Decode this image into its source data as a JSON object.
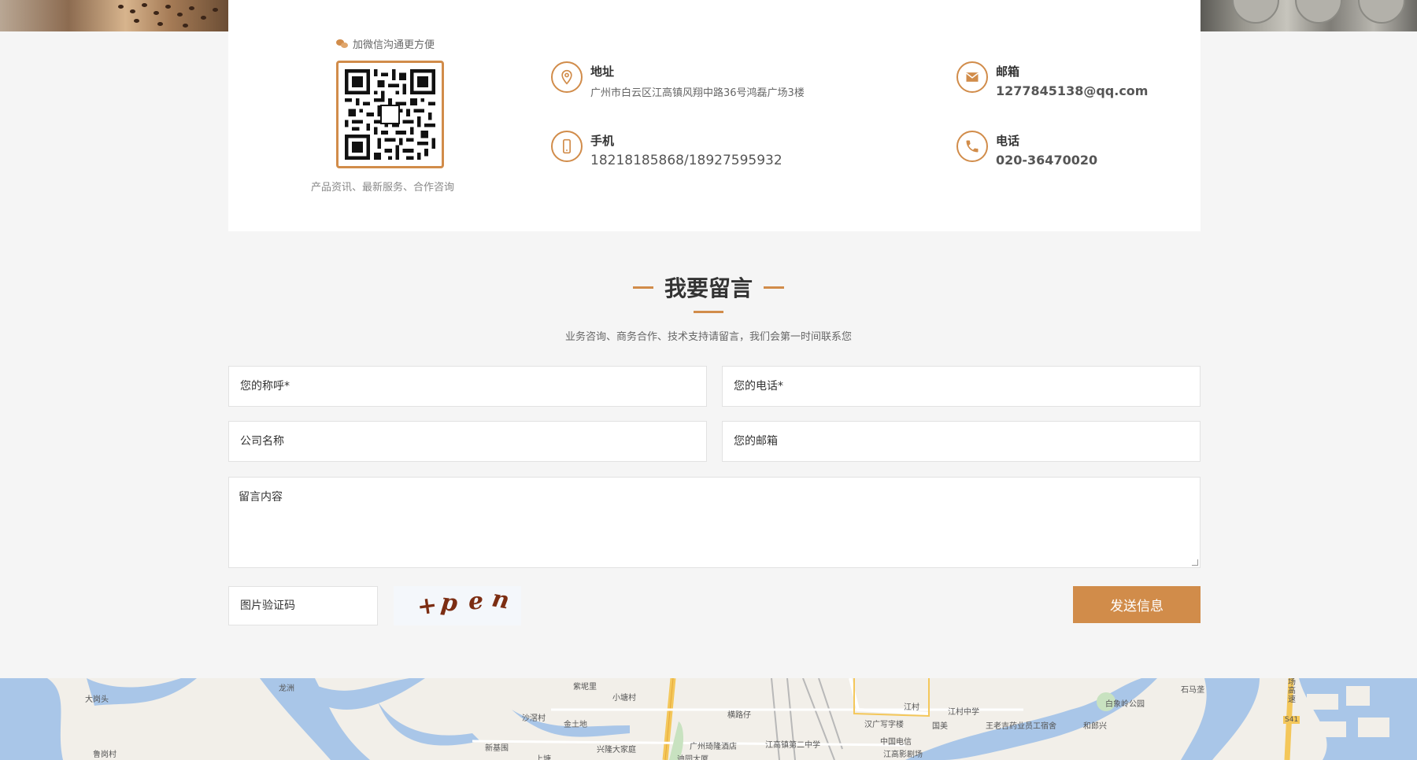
{
  "wechat": {
    "title": "加微信沟通更方便",
    "subtitle": "产品资讯、最新服务、合作咨询"
  },
  "contact": {
    "address": {
      "label": "地址",
      "value": "广州市白云区江高镇风翔中路36号鸿磊广场3楼"
    },
    "email": {
      "label": "邮箱",
      "value": "1277845138@qq.com"
    },
    "mobile": {
      "label": "手机",
      "value": "18218185868/18927595932"
    },
    "phone": {
      "label": "电话",
      "value": "020-36470020"
    }
  },
  "message": {
    "title": "我要留言",
    "subtitle": "业务咨询、商务合作、技术支持请留言，我们会第一时间联系您"
  },
  "form": {
    "name_placeholder": "您的称呼*",
    "phone_placeholder": "您的电话*",
    "company_placeholder": "公司名称",
    "email_placeholder": "您的邮箱",
    "content_placeholder": "留言内容",
    "captcha_placeholder": "图片验证码",
    "captcha_chars": [
      "+",
      "p",
      "e",
      "n"
    ],
    "submit_label": "发送信息"
  },
  "map": {
    "places": [
      "大岗头",
      "龙洲",
      "鲁岗村",
      "紫坭里",
      "小塘村",
      "沙滘村",
      "金土地",
      "新基围",
      "上塘",
      "兴隆大家庭",
      "横路仔",
      "广州琦隆酒店",
      "江高镇第二中学",
      "迪园大厦",
      "江村",
      "江村中学",
      "汉广写字楼",
      "国美",
      "王老吉药业员工宿舍",
      "中国电信",
      "江高影剧场",
      "和郎兴",
      "白象岭公园",
      "石马垄",
      "场高速",
      "S41"
    ]
  },
  "colors": {
    "accent": "#d18c4a",
    "background": "#f5f5f5",
    "card": "#ffffff"
  }
}
